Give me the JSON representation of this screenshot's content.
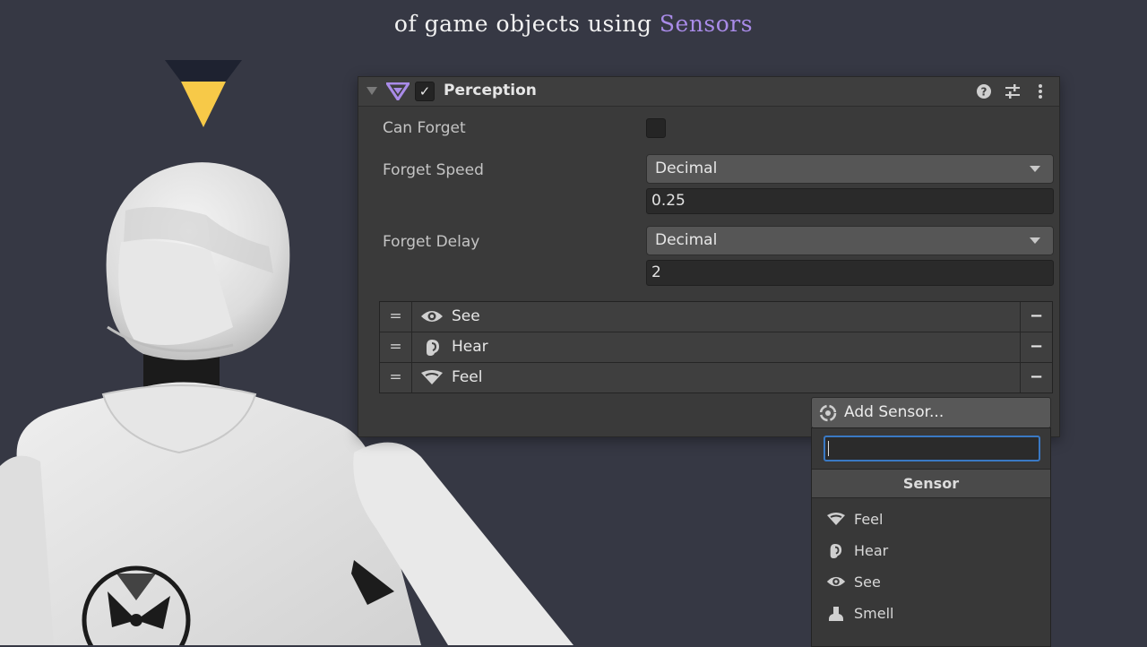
{
  "heading": {
    "line_prefix": "of game objects using ",
    "line_accent": "Sensors"
  },
  "colors": {
    "background": "#363844",
    "accent_purple": "#a98be8",
    "logo_yellow": "#f7c948",
    "logo_dark": "#1e2230",
    "focus_blue": "#3a79c4"
  },
  "component": {
    "title": "Perception",
    "icon": "perception-triangle-icon",
    "enabled": true,
    "header_buttons": [
      "help-icon",
      "presets-icon",
      "more-options-icon"
    ]
  },
  "fields": {
    "can_forget": {
      "label": "Can Forget",
      "checked": false
    },
    "forget_speed": {
      "label": "Forget Speed",
      "type": "Decimal",
      "value": "0.25"
    },
    "forget_delay": {
      "label": "Forget Delay",
      "type": "Decimal",
      "value": "2"
    }
  },
  "sensors": [
    {
      "label": "See",
      "icon": "eye-icon"
    },
    {
      "label": "Hear",
      "icon": "ear-icon"
    },
    {
      "label": "Feel",
      "icon": "feel-wave-icon"
    }
  ],
  "list_controls": {
    "handle": "=",
    "remove": "−"
  },
  "add_sensor": {
    "label": "Add Sensor...",
    "search_value": "",
    "section": "Sensor",
    "options": [
      {
        "label": "Feel",
        "icon": "feel-wave-icon"
      },
      {
        "label": "Hear",
        "icon": "ear-icon"
      },
      {
        "label": "See",
        "icon": "eye-icon"
      },
      {
        "label": "Smell",
        "icon": "nose-icon"
      }
    ]
  }
}
